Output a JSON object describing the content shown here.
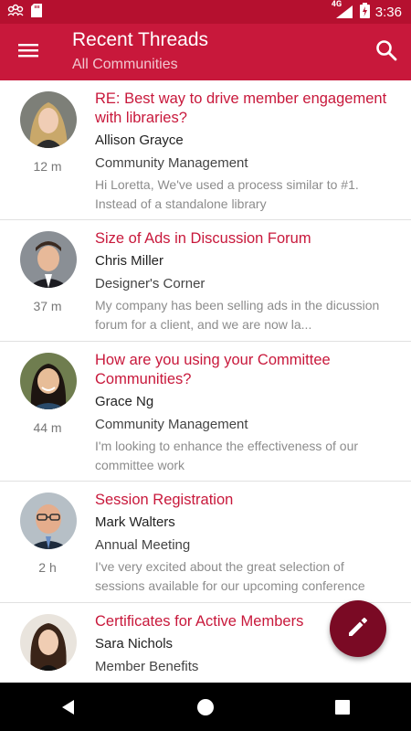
{
  "status_bar": {
    "network": "4G",
    "time": "3:36"
  },
  "app_bar": {
    "title": "Recent Threads",
    "subtitle": "All Communities",
    "menu_icon": "hamburger-menu-icon",
    "search_icon": "search-icon"
  },
  "threads": [
    {
      "title": "RE: Best way to drive member engagement with libraries?",
      "author": "Allison Grayce",
      "community": "Community Management",
      "preview": "Hi Loretta, We've used a process similar to #1. Instead of a standalone library",
      "time": "12 m"
    },
    {
      "title": "Size of Ads in Discussion Forum",
      "author": "Chris Miller",
      "community": "Designer's Corner",
      "preview": "My company has been selling ads in the dicussion forum for a client, and we are now la...",
      "time": "37 m"
    },
    {
      "title": "How are you using your Committee Communities?",
      "author": "Grace Ng",
      "community": "Community Management",
      "preview": "I'm looking to enhance the effectiveness of our committee work",
      "time": "44 m"
    },
    {
      "title": "Session Registration",
      "author": "Mark Walters",
      "community": "Annual Meeting",
      "preview": "I've very excited about the great selection of sessions available for our upcoming conference",
      "time": "2 h"
    },
    {
      "title": "Certificates for Active Members",
      "author": "Sara Nichols",
      "community": "Member Benefits",
      "preview": "",
      "time": ""
    }
  ],
  "colors": {
    "primary": "#c8183b",
    "status_bar": "#b5102f",
    "fab": "#7a0a24"
  }
}
